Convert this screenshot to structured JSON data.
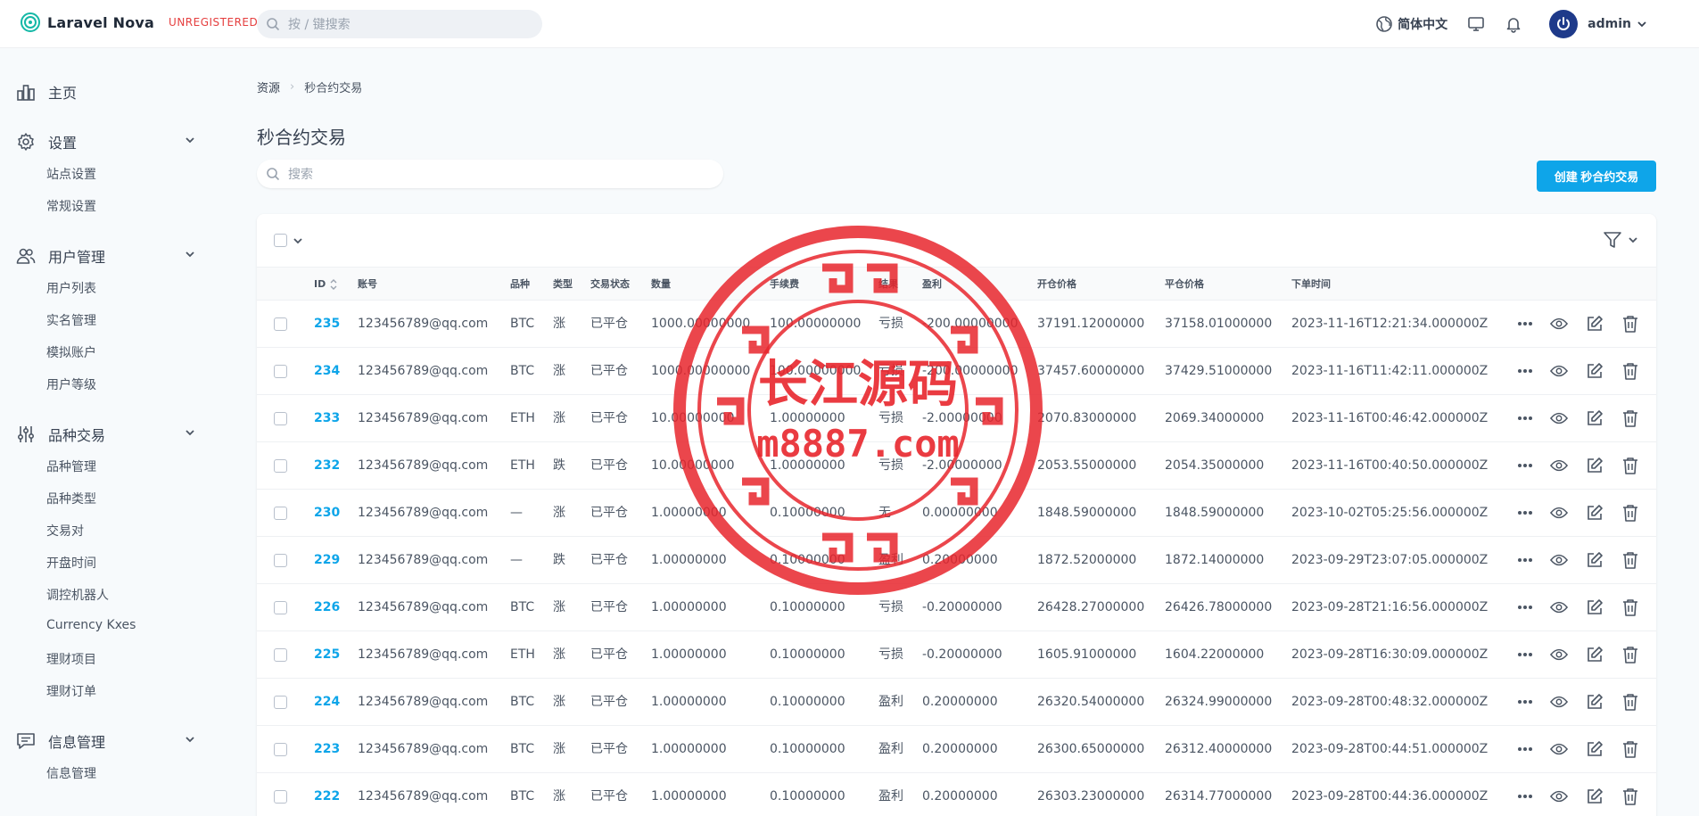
{
  "header": {
    "brand_name": "Laravel Nova",
    "brand_badge": "UNREGISTERED",
    "search_placeholder": "按 / 键搜索",
    "language": "简体中文",
    "user_name": "admin"
  },
  "sidebar": {
    "home": "主页",
    "groups": [
      {
        "label": "设置",
        "items": [
          "站点设置",
          "常规设置"
        ]
      },
      {
        "label": "用户管理",
        "items": [
          "用户列表",
          "实名管理",
          "模拟账户",
          "用户等级"
        ]
      },
      {
        "label": "品种交易",
        "items": [
          "品种管理",
          "品种类型",
          "交易对",
          "开盘时间",
          "调控机器人",
          "Currency Kxes",
          "理财项目",
          "理财订单"
        ]
      },
      {
        "label": "信息管理",
        "items": [
          "信息管理"
        ]
      }
    ]
  },
  "breadcrumb": {
    "root": "资源",
    "current": "秒合约交易"
  },
  "page": {
    "title": "秒合约交易",
    "search_placeholder": "搜索",
    "create_button": "创建 秒合约交易"
  },
  "table": {
    "columns": [
      "ID",
      "账号",
      "品种",
      "类型",
      "交易状态",
      "数量",
      "手续费",
      "结果",
      "盈利",
      "开仓价格",
      "平仓价格",
      "下单时间"
    ],
    "rows": [
      {
        "id": "235",
        "account": "123456789@qq.com",
        "symbol": "BTC",
        "type": "涨",
        "status": "已平仓",
        "qty": "1000.00000000",
        "fee": "100.00000000",
        "result": "亏损",
        "profit": "-200.00000000",
        "open": "37191.12000000",
        "close": "37158.01000000",
        "time": "2023-11-16T12:21:34.000000Z"
      },
      {
        "id": "234",
        "account": "123456789@qq.com",
        "symbol": "BTC",
        "type": "涨",
        "status": "已平仓",
        "qty": "1000.00000000",
        "fee": "100.00000000",
        "result": "亏损",
        "profit": "-200.00000000",
        "open": "37457.60000000",
        "close": "37429.51000000",
        "time": "2023-11-16T11:42:11.000000Z"
      },
      {
        "id": "233",
        "account": "123456789@qq.com",
        "symbol": "ETH",
        "type": "涨",
        "status": "已平仓",
        "qty": "10.00000000",
        "fee": "1.00000000",
        "result": "亏损",
        "profit": "-2.00000000",
        "open": "2070.83000000",
        "close": "2069.34000000",
        "time": "2023-11-16T00:46:42.000000Z"
      },
      {
        "id": "232",
        "account": "123456789@qq.com",
        "symbol": "ETH",
        "type": "跌",
        "status": "已平仓",
        "qty": "10.00000000",
        "fee": "1.00000000",
        "result": "亏损",
        "profit": "-2.00000000",
        "open": "2053.55000000",
        "close": "2054.35000000",
        "time": "2023-11-16T00:40:50.000000Z"
      },
      {
        "id": "230",
        "account": "123456789@qq.com",
        "symbol": "—",
        "type": "涨",
        "status": "已平仓",
        "qty": "1.00000000",
        "fee": "0.10000000",
        "result": "无",
        "profit": "0.00000000",
        "open": "1848.59000000",
        "close": "1848.59000000",
        "time": "2023-10-02T05:25:56.000000Z"
      },
      {
        "id": "229",
        "account": "123456789@qq.com",
        "symbol": "—",
        "type": "跌",
        "status": "已平仓",
        "qty": "1.00000000",
        "fee": "0.10000000",
        "result": "盈利",
        "profit": "0.20000000",
        "open": "1872.52000000",
        "close": "1872.14000000",
        "time": "2023-09-29T23:07:05.000000Z"
      },
      {
        "id": "226",
        "account": "123456789@qq.com",
        "symbol": "BTC",
        "type": "涨",
        "status": "已平仓",
        "qty": "1.00000000",
        "fee": "0.10000000",
        "result": "亏损",
        "profit": "-0.20000000",
        "open": "26428.27000000",
        "close": "26426.78000000",
        "time": "2023-09-28T21:16:56.000000Z"
      },
      {
        "id": "225",
        "account": "123456789@qq.com",
        "symbol": "ETH",
        "type": "涨",
        "status": "已平仓",
        "qty": "1.00000000",
        "fee": "0.10000000",
        "result": "亏损",
        "profit": "-0.20000000",
        "open": "1605.91000000",
        "close": "1604.22000000",
        "time": "2023-09-28T16:30:09.000000Z"
      },
      {
        "id": "224",
        "account": "123456789@qq.com",
        "symbol": "BTC",
        "type": "涨",
        "status": "已平仓",
        "qty": "1.00000000",
        "fee": "0.10000000",
        "result": "盈利",
        "profit": "0.20000000",
        "open": "26320.54000000",
        "close": "26324.99000000",
        "time": "2023-09-28T00:48:32.000000Z"
      },
      {
        "id": "223",
        "account": "123456789@qq.com",
        "symbol": "BTC",
        "type": "涨",
        "status": "已平仓",
        "qty": "1.00000000",
        "fee": "0.10000000",
        "result": "盈利",
        "profit": "0.20000000",
        "open": "26300.65000000",
        "close": "26312.40000000",
        "time": "2023-09-28T00:44:51.000000Z"
      },
      {
        "id": "222",
        "account": "123456789@qq.com",
        "symbol": "BTC",
        "type": "涨",
        "status": "已平仓",
        "qty": "1.00000000",
        "fee": "0.10000000",
        "result": "盈利",
        "profit": "0.20000000",
        "open": "26303.23000000",
        "close": "26314.77000000",
        "time": "2023-09-28T00:44:36.000000Z"
      }
    ],
    "row_actions": [
      "more-icon",
      "view-icon",
      "edit-icon",
      "delete-icon"
    ]
  },
  "watermark": {
    "line1": "长江源码",
    "line2": "m8887.com",
    "color": "#e8262d"
  },
  "colors": {
    "accent": "#0ea5e9",
    "badge": "#e53e3e",
    "logo": "#14b8a6"
  }
}
